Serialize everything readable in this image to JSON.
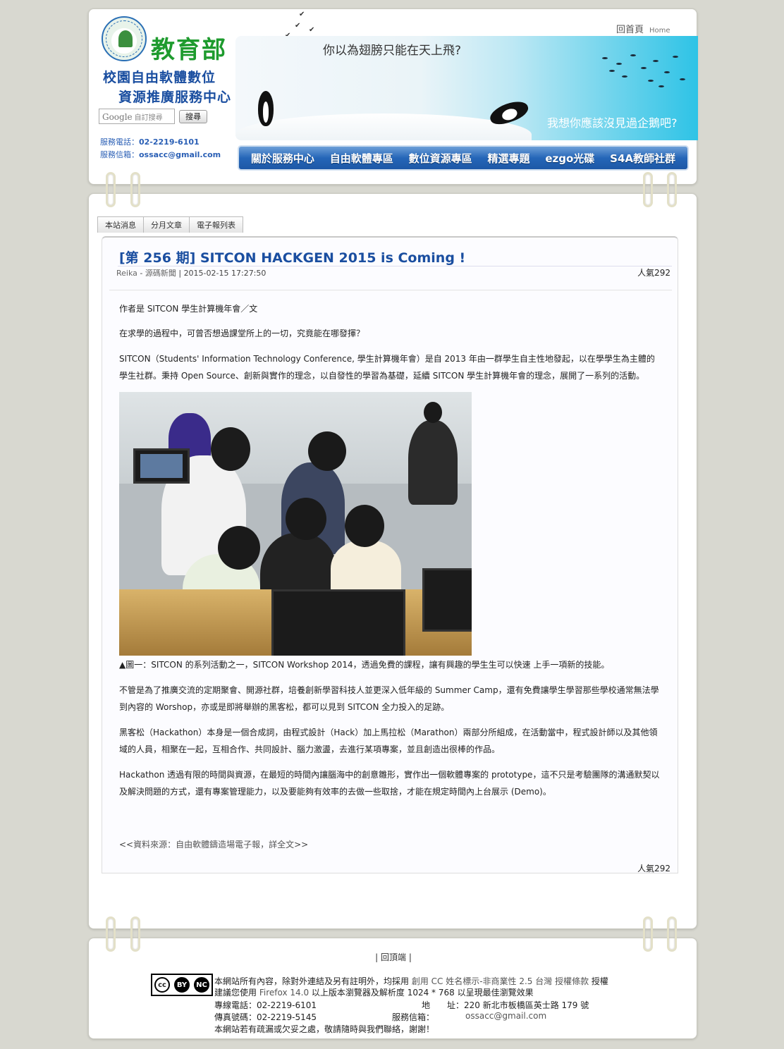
{
  "header": {
    "ministry_name": "教育部",
    "center_name_line1": "校園自由軟體數位",
    "center_name_line2": "資源推廣服務中心",
    "search_placeholder": "自訂搜尋",
    "search_brand": "Google",
    "search_button": "搜尋",
    "phone_label": "服務電話：",
    "phone": "02-2219-6101",
    "mail_label": "服務信箱：",
    "mail": "ossacc@gmail.com",
    "home_zh": "回首頁",
    "home_en": "Home",
    "banner_line1": "你以為翅膀只能在天上飛?",
    "banner_line2": "我想你應該沒見過企鵝吧?"
  },
  "nav": {
    "items": [
      {
        "label": "關於服務中心"
      },
      {
        "label": "自由軟體專區"
      },
      {
        "label": "數位資源專區"
      },
      {
        "label": "精選專題"
      },
      {
        "label": "ezgo光碟"
      },
      {
        "label": "S4A教師社群"
      }
    ]
  },
  "tabs": [
    {
      "label": "本站消息"
    },
    {
      "label": "分月文章"
    },
    {
      "label": "電子報列表"
    }
  ],
  "article": {
    "title": "[第 256 期] SITCON HACKGEN 2015 is Coming !",
    "author": "Reika",
    "sep1": " - ",
    "category": "源碼新聞",
    "sep2": " | ",
    "datetime": "2015-02-15 17:27:50",
    "popularity": "人氣292",
    "paragraphs": [
      "作者是 SITCON 學生計算機年會／文",
      "在求學的過程中，可曾否想過課堂所上的一切，究竟能在哪發揮？",
      "SITCON（Students' Information Technology Conference, 學生計算機年會）是自 2013 年由一群學生自主性地發起，以在學學生為主體的學生社群。秉持 Open Source、創新與實作的理念，以自發性的學習為基礎，延續 SITCON 學生計算機年會的理念，展開了一系列的活動。",
      "▲圖一：SITCON 的系列活動之一，SITCON Workshop 2014，透過免費的課程，讓有興趣的學生生可以快速 上手一項新的技能。",
      "不管是為了推廣交流的定期聚會、開源社群，培養創新學習科技人並更深入低年級的 Summer Camp，還有免費讓學生學習那些學校通常無法學到內容的 Worshop，亦或是即將舉辦的黑客松，都可以見到 SITCON 全力投入的足跡。",
      "黑客松（Hackathon）本身是一個合成詞，由程式設計（Hack）加上馬拉松（Marathon）兩部分所組成，在活動當中，程式設計師以及其他領域的人員，相聚在一起，互相合作、共同設計、腦力激盪，去進行某項專案，並且創造出很棒的作品。",
      "Hackathon 透過有限的時間與資源，在最短的時間內讓腦海中的創意雛形，實作出一個軟體專案的 prototype，這不只是考驗團隊的溝通默契以及解決問題的方式，還有專案管理能力，以及要能夠有效率的去做一些取捨，才能在規定時間內上台展示 (Demo)。"
    ],
    "source_prefix": "<<",
    "source_text": "資料來源：自由軟體鑄造場電子報，詳全文",
    "source_suffix": ">>"
  },
  "footer": {
    "back_to_top": "| 回頂端 |",
    "cc_labels": [
      "cc",
      "BY",
      "NC"
    ],
    "line1_a": "本網站所有內容，除對外連結及另有註明外，均採用 ",
    "line1_link": "創用 CC 姓名標示-非商業性 2.5 台灣 授權條款",
    "line1_b": " 授權",
    "line2_a": "建議您使用 ",
    "line2_link": "Firefox 14.0",
    "line2_b": " 以上版本瀏覽器及解析度 1024 * 768 以呈現最佳瀏覽效果",
    "tel_label": "專線電話：02-2219-6101",
    "addr_label": "地　　址：220 新北市板橋區英士路 179 號",
    "fax_label": "傳真號碼：02-2219-5145",
    "mail_label": "服務信箱：",
    "mail": "ossacc@gmail.com",
    "closing": "本網站若有疏漏或欠妥之處，敬請隨時與我們聯絡，謝謝！"
  }
}
